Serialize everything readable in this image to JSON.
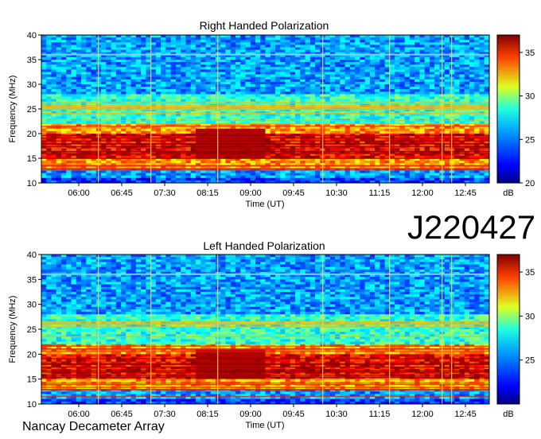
{
  "station_id": "J220427",
  "footer": "Nancay Decameter Array",
  "chart_data": [
    {
      "type": "heatmap",
      "title": "Right Handed Polarization",
      "xlabel": "Time (UT)",
      "ylabel": "Frequency (MHz)",
      "x_ticks": [
        "06:00",
        "06:45",
        "07:30",
        "08:15",
        "09:00",
        "09:45",
        "10:30",
        "11:15",
        "12:00",
        "12:45"
      ],
      "y_ticks": [
        10,
        15,
        20,
        25,
        30,
        35,
        40
      ],
      "ylim": [
        10,
        40
      ],
      "colorbar": {
        "label": "dB",
        "range": [
          20,
          37
        ],
        "ticks": [
          20,
          25,
          30,
          35
        ],
        "colormap": "jet"
      },
      "features": {
        "intense_band_MHz": [
          13,
          22
        ],
        "peak_band_MHz": [
          15,
          20
        ],
        "rfi_line_MHz": 36.2,
        "bright_vertical_time_UT": [
          "06:20",
          "07:15",
          "08:25",
          "10:15",
          "11:25",
          "12:20",
          "12:30"
        ]
      }
    },
    {
      "type": "heatmap",
      "title": "Left Handed Polarization",
      "xlabel": "Time (UT)",
      "ylabel": "Frequency (MHz)",
      "x_ticks": [
        "06:00",
        "06:45",
        "07:30",
        "08:15",
        "09:00",
        "09:45",
        "10:30",
        "11:15",
        "12:00",
        "12:45"
      ],
      "y_ticks": [
        10,
        15,
        20,
        25,
        30,
        35,
        40
      ],
      "ylim": [
        10,
        40
      ],
      "colorbar": {
        "label": "dB",
        "range": [
          20,
          37
        ],
        "ticks": [
          25,
          30,
          35
        ],
        "colormap": "jet"
      },
      "features": {
        "intense_band_MHz": [
          13,
          22
        ],
        "peak_band_MHz": [
          15,
          20
        ],
        "rfi_line_MHz": 36.2,
        "bright_vertical_time_UT": [
          "06:20",
          "07:15",
          "08:25",
          "10:15",
          "11:25",
          "12:20",
          "12:30"
        ]
      }
    }
  ]
}
